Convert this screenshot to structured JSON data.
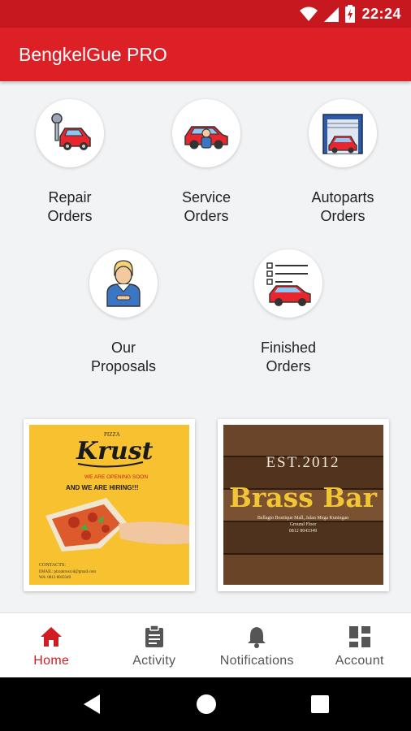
{
  "status_bar": {
    "time": "22:24",
    "icons": [
      "wifi-icon",
      "signal-icon",
      "battery-charging-icon"
    ]
  },
  "app": {
    "title": "BengkelGue PRO",
    "accent": "#dd1f26"
  },
  "menu": {
    "items": [
      {
        "line1": "Repair",
        "line2": "Orders",
        "icon": "repair-car-icon"
      },
      {
        "line1": "Service",
        "line2": "Orders",
        "icon": "service-car-icon"
      },
      {
        "line1": "Autoparts",
        "line2": "Orders",
        "icon": "garage-icon"
      },
      {
        "line1": "Our",
        "line2": "Proposals",
        "icon": "mechanic-icon"
      },
      {
        "line1": "Finished",
        "line2": "Orders",
        "icon": "checklist-car-icon"
      }
    ]
  },
  "promos": {
    "krust": {
      "brand_small": "PIZZA",
      "brand": "Krust",
      "line1": "WE ARE OPENING SOON",
      "line2": "AND WE ARE HIRING!!!",
      "contact_title": "CONTACTS:",
      "contact_email": "EMAIL: pizzakrust.id@gmail.com",
      "contact_wa": "WA: 0812 8043349"
    },
    "brass": {
      "est": "EST.2012",
      "name": "Brass Bar",
      "address1": "Bellagio Boutique Mall, Jalan Mega Kuningan",
      "address2": "Ground Floor",
      "phone": "0812 8043349"
    }
  },
  "bottom_nav": {
    "items": [
      {
        "label": "Home",
        "icon": "home-icon",
        "active": true
      },
      {
        "label": "Activity",
        "icon": "clipboard-icon",
        "active": false
      },
      {
        "label": "Notifications",
        "icon": "bell-icon",
        "active": false
      },
      {
        "label": "Account",
        "icon": "dashboard-icon",
        "active": false
      }
    ]
  },
  "system_nav": {
    "icons": [
      "back-icon",
      "home-circle-icon",
      "recents-icon"
    ]
  }
}
